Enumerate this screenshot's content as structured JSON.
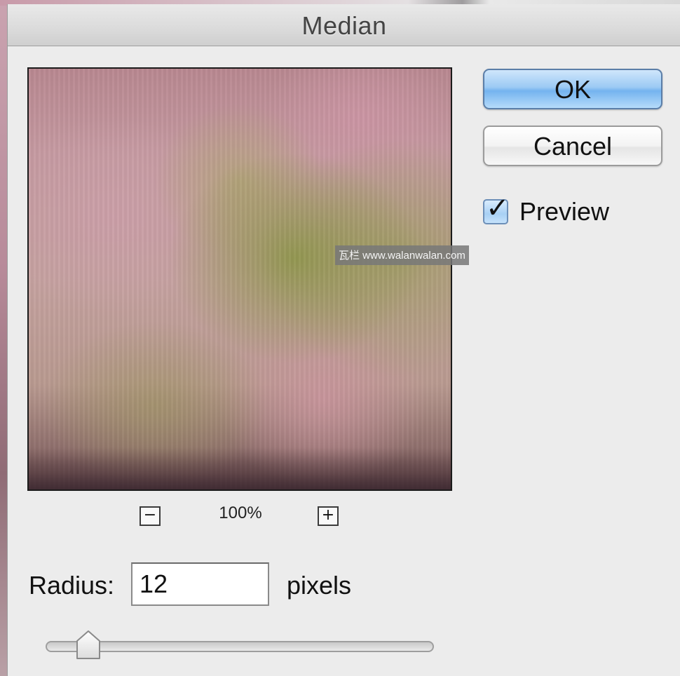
{
  "dialog": {
    "title": "Median"
  },
  "buttons": {
    "ok_label": "OK",
    "cancel_label": "Cancel"
  },
  "preview_toggle": {
    "label": "Preview",
    "checked": true
  },
  "zoom": {
    "minus_glyph": "−",
    "plus_glyph": "+",
    "level": "100%"
  },
  "radius": {
    "label": "Radius:",
    "value": "12",
    "unit": "pixels",
    "slider_fraction": 0.11
  },
  "watermark": {
    "text": "瓦栏 www.walanwalan.com"
  },
  "icons": {
    "checkmark": "checkmark-icon",
    "zoom_out": "minus-icon",
    "zoom_in": "plus-icon"
  },
  "colors": {
    "ok_button": "#74b3ef",
    "checkbox": "#a8d0f4"
  }
}
